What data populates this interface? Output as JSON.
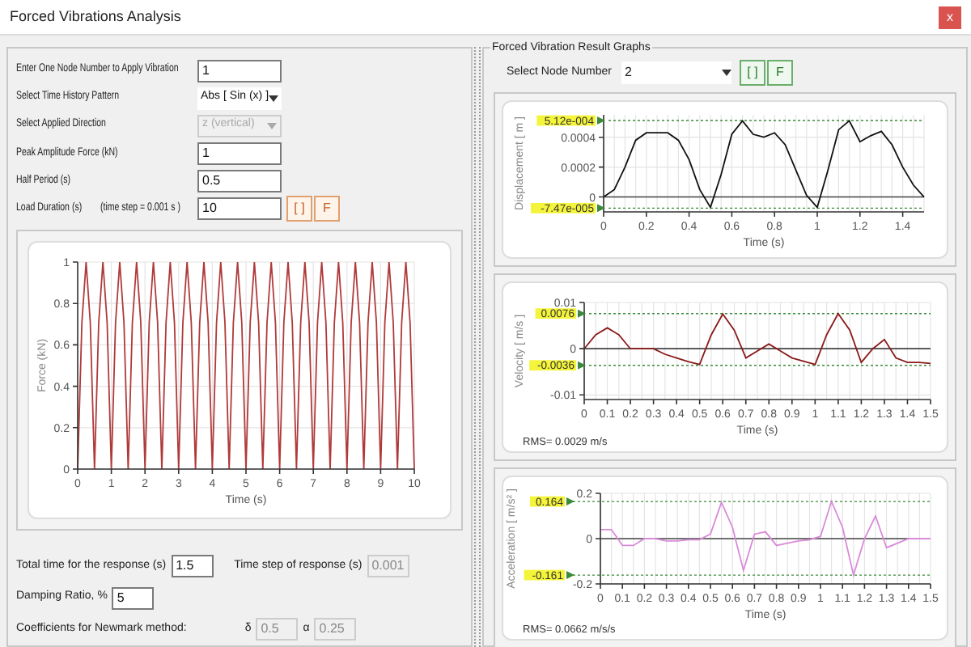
{
  "window": {
    "title": "Forced Vibrations Analysis",
    "close": "x"
  },
  "input_panel": {
    "rows": [
      {
        "kind": "text",
        "label": "Enter One Node Number to Apply Vibration",
        "value": "1",
        "disabled": false
      },
      {
        "kind": "select",
        "label": "Select Time History Pattern",
        "value": "Abs [ Sin (x) ]",
        "disabled": false
      },
      {
        "kind": "select",
        "label": "Select Applied Direction",
        "value": "z (vertical)",
        "disabled": true
      },
      {
        "kind": "text",
        "label": "Peak Amplitude Force (kN)",
        "value": "1",
        "disabled": false
      },
      {
        "kind": "text",
        "label": "Half Period (s)",
        "value": "0.5",
        "disabled": false
      },
      {
        "kind": "text",
        "label": "Load Duration (s)",
        "note": "(time step = 0.001 s )",
        "value": "10",
        "disabled": false,
        "buttons": [
          "[ ]",
          "F"
        ]
      }
    ],
    "chart_data": {
      "type": "line",
      "grid": true,
      "xlabel": "Time (s)",
      "ylabel": "Force (kN)",
      "xlim": [
        0,
        10
      ],
      "ylim": [
        0,
        1
      ],
      "xticks": [
        0,
        1,
        2,
        3,
        4,
        5,
        6,
        7,
        8,
        9,
        10
      ],
      "yticks": [
        0,
        0.2,
        0.4,
        0.6,
        0.8,
        1
      ],
      "x": [
        0,
        0.125,
        0.25,
        0.375,
        0.5,
        0.625,
        0.75,
        0.875,
        1,
        1.125,
        1.25,
        1.375,
        1.5,
        1.625,
        1.75,
        1.875,
        2,
        2.125,
        2.25,
        2.375,
        2.5,
        2.625,
        2.75,
        2.875,
        3,
        3.125,
        3.25,
        3.375,
        3.5,
        3.625,
        3.75,
        3.875,
        4,
        4.125,
        4.25,
        4.375,
        4.5,
        4.625,
        4.75,
        4.875,
        5,
        5.125,
        5.25,
        5.375,
        5.5,
        5.625,
        5.75,
        5.875,
        6,
        6.125,
        6.25,
        6.375,
        6.5,
        6.625,
        6.75,
        6.875,
        7,
        7.125,
        7.25,
        7.375,
        7.5,
        7.625,
        7.75,
        7.875,
        8,
        8.125,
        8.25,
        8.375,
        8.5,
        8.625,
        8.75,
        8.875,
        9,
        9.125,
        9.25,
        9.375,
        9.5,
        9.625,
        9.75,
        9.875,
        10
      ],
      "series": [
        {
          "color": "#b03a3a",
          "values": [
            0,
            0.707,
            1,
            0.707,
            0,
            0.707,
            1,
            0.707,
            0,
            0.707,
            1,
            0.707,
            0,
            0.707,
            1,
            0.707,
            0,
            0.707,
            1,
            0.707,
            0,
            0.707,
            1,
            0.707,
            0,
            0.707,
            1,
            0.707,
            0,
            0.707,
            1,
            0.707,
            0,
            0.707,
            1,
            0.707,
            0,
            0.707,
            1,
            0.707,
            0,
            0.707,
            1,
            0.707,
            0,
            0.707,
            1,
            0.707,
            0,
            0.707,
            1,
            0.707,
            0,
            0.707,
            1,
            0.707,
            0,
            0.707,
            1,
            0.707,
            0,
            0.707,
            1,
            0.707,
            0,
            0.707,
            1,
            0.707,
            0,
            0.707,
            1,
            0.707,
            0,
            0.707,
            1,
            0.707,
            0,
            0.707,
            1,
            0.707,
            0
          ]
        }
      ]
    },
    "bottom_rows": [
      [
        {
          "label": "Total time for the response (s)",
          "value": "1.5",
          "disabled": false
        },
        {
          "label": "Time step of response (s)",
          "value": "0.001",
          "disabled": true
        }
      ],
      [
        {
          "label": "Damping Ratio, %",
          "value": "5",
          "disabled": false
        }
      ],
      [
        {
          "label": "Coefficients for Newmark method:"
        },
        {
          "label": "δ",
          "value": "0.5",
          "disabled": true
        },
        {
          "label": "α",
          "value": "0.25",
          "disabled": true
        }
      ]
    ]
  },
  "results_panel": {
    "title": "Forced Vibration Result Graphs",
    "node_label": "Select Node Number",
    "node_value": "2",
    "buttons": [
      "[ ]",
      "F"
    ],
    "graphs": [
      {
        "chart_data": {
          "type": "line",
          "grid": true,
          "xlabel": "Time (s)",
          "ylabel": "Displacement [ m ]",
          "xlim": [
            0,
            1.5
          ],
          "ylim": [
            -0.0001,
            0.00055
          ],
          "xticks": [
            0,
            0.2,
            0.4,
            0.6,
            0.8,
            1,
            1.2,
            1.4
          ],
          "yticks": [
            0,
            0.0002,
            0.0004
          ],
          "x": [
            0,
            0.05,
            0.1,
            0.15,
            0.2,
            0.25,
            0.3,
            0.35,
            0.4,
            0.45,
            0.5,
            0.55,
            0.6,
            0.65,
            0.7,
            0.75,
            0.8,
            0.85,
            0.9,
            0.95,
            1,
            1.05,
            1.1,
            1.15,
            1.2,
            1.25,
            1.3,
            1.35,
            1.4,
            1.45,
            1.5
          ],
          "series": [
            {
              "color": "#111111",
              "values": [
                0,
                5e-05,
                0.0002,
                0.00038,
                0.00043,
                0.00043,
                0.00043,
                0.00038,
                0.00025,
                5e-05,
                -7e-05,
                0.00015,
                0.00042,
                0.00051,
                0.00042,
                0.0004,
                0.00043,
                0.00035,
                0.00018,
                1e-05,
                -7e-05,
                0.00018,
                0.00045,
                0.00051,
                0.00037,
                0.00041,
                0.00044,
                0.00035,
                0.0002,
                8e-05,
                0
              ]
            }
          ],
          "ref_lines": [
            {
              "axis": "y",
              "value": 0.000512,
              "label": "5.12e-004",
              "color": "#3a8a3a"
            },
            {
              "axis": "y",
              "value": -7.47e-05,
              "label": "-7.47e-005",
              "color": "#3a8a3a"
            }
          ]
        }
      },
      {
        "rms": "RMS= 0.0029 m/s",
        "chart_data": {
          "type": "line",
          "grid": true,
          "xlabel": "Time (s)",
          "ylabel": "Velocity [ m/s ]",
          "xlim": [
            0,
            1.5
          ],
          "ylim": [
            -0.011,
            0.01
          ],
          "xticks": [
            0,
            0.1,
            0.2,
            0.3,
            0.4,
            0.5,
            0.6,
            0.7,
            0.8,
            0.9,
            1,
            1.1,
            1.2,
            1.3,
            1.4,
            1.5
          ],
          "yticks": [
            -0.01,
            0,
            0.01
          ],
          "x": [
            0,
            0.05,
            0.1,
            0.15,
            0.2,
            0.25,
            0.3,
            0.35,
            0.4,
            0.45,
            0.5,
            0.55,
            0.6,
            0.65,
            0.7,
            0.75,
            0.8,
            0.85,
            0.9,
            0.95,
            1,
            1.05,
            1.1,
            1.15,
            1.2,
            1.25,
            1.3,
            1.35,
            1.4,
            1.45,
            1.5
          ],
          "series": [
            {
              "color": "#8b1a1a",
              "values": [
                0,
                0.003,
                0.0045,
                0.003,
                0,
                0,
                0,
                -0.0012,
                -0.002,
                -0.0028,
                -0.0034,
                0.003,
                0.0075,
                0.004,
                -0.002,
                -0.0005,
                0.001,
                -0.0005,
                -0.002,
                -0.0027,
                -0.0034,
                0.003,
                0.0076,
                0.004,
                -0.003,
                0,
                0.002,
                -0.002,
                -0.003,
                -0.003,
                -0.0032
              ]
            }
          ],
          "ref_lines": [
            {
              "axis": "y",
              "value": 0.0076,
              "label": "0.0076",
              "color": "#3a8a3a"
            },
            {
              "axis": "y",
              "value": -0.0036,
              "label": "-0.0036",
              "color": "#3a8a3a"
            }
          ]
        }
      },
      {
        "rms": "RMS= 0.0662 m/s/s",
        "chart_data": {
          "type": "line",
          "grid": true,
          "xlabel": "Time (s)",
          "ylabel": "Acceleration [ m/s² ]",
          "xlim": [
            0,
            1.5
          ],
          "ylim": [
            -0.2,
            0.2
          ],
          "xticks": [
            0,
            0.1,
            0.2,
            0.3,
            0.4,
            0.5,
            0.6,
            0.7,
            0.8,
            0.9,
            1,
            1.1,
            1.2,
            1.3,
            1.4,
            1.5
          ],
          "yticks": [
            -0.2,
            0,
            0.2
          ],
          "x": [
            0,
            0.05,
            0.1,
            0.15,
            0.2,
            0.25,
            0.3,
            0.35,
            0.4,
            0.45,
            0.5,
            0.55,
            0.6,
            0.65,
            0.7,
            0.75,
            0.8,
            0.85,
            0.9,
            0.95,
            1,
            1.05,
            1.1,
            1.15,
            1.2,
            1.25,
            1.3,
            1.35,
            1.4,
            1.45,
            1.5
          ],
          "series": [
            {
              "color": "#d98ad9",
              "values": [
                0.04,
                0.04,
                -0.03,
                -0.03,
                0,
                0,
                -0.01,
                -0.01,
                -0.005,
                -0.005,
                0.02,
                0.16,
                0.05,
                -0.14,
                0.02,
                0.03,
                -0.03,
                -0.02,
                -0.01,
                -0.005,
                0.01,
                0.164,
                0.05,
                -0.161,
                0,
                0.1,
                -0.04,
                -0.02,
                0,
                0,
                0
              ]
            }
          ],
          "ref_lines": [
            {
              "axis": "y",
              "value": 0.164,
              "label": "0.164",
              "color": "#3a8a3a"
            },
            {
              "axis": "y",
              "value": -0.161,
              "label": "-0.161",
              "color": "#3a8a3a"
            }
          ]
        }
      }
    ]
  }
}
